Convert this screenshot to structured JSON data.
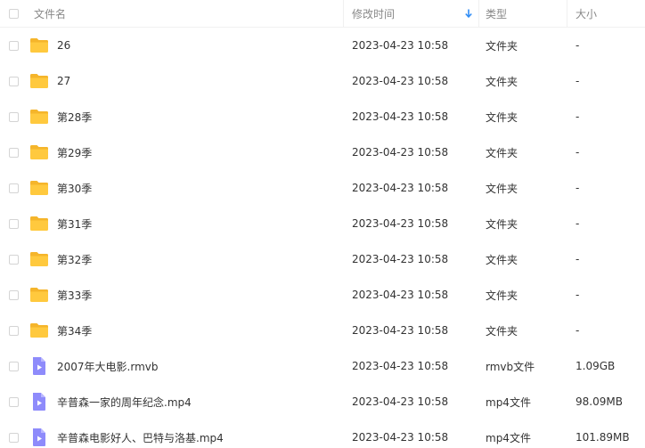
{
  "header": {
    "name_label": "文件名",
    "time_label": "修改时间",
    "type_label": "类型",
    "size_label": "大小",
    "sort_icon": "sort-arrow-down-icon"
  },
  "colors": {
    "folder": "#FFC93E",
    "video": "#8E8BFB",
    "sort_arrow": "#2F8CF5"
  },
  "files": [
    {
      "name": "26",
      "time": "2023-04-23 10:58",
      "type": "文件夹",
      "size": "-",
      "icon": "folder-icon"
    },
    {
      "name": "27",
      "time": "2023-04-23 10:58",
      "type": "文件夹",
      "size": "-",
      "icon": "folder-icon"
    },
    {
      "name": "第28季",
      "time": "2023-04-23 10:58",
      "type": "文件夹",
      "size": "-",
      "icon": "folder-icon"
    },
    {
      "name": "第29季",
      "time": "2023-04-23 10:58",
      "type": "文件夹",
      "size": "-",
      "icon": "folder-icon"
    },
    {
      "name": "第30季",
      "time": "2023-04-23 10:58",
      "type": "文件夹",
      "size": "-",
      "icon": "folder-icon"
    },
    {
      "name": "第31季",
      "time": "2023-04-23 10:58",
      "type": "文件夹",
      "size": "-",
      "icon": "folder-icon"
    },
    {
      "name": "第32季",
      "time": "2023-04-23 10:58",
      "type": "文件夹",
      "size": "-",
      "icon": "folder-icon"
    },
    {
      "name": "第33季",
      "time": "2023-04-23 10:58",
      "type": "文件夹",
      "size": "-",
      "icon": "folder-icon"
    },
    {
      "name": "第34季",
      "time": "2023-04-23 10:58",
      "type": "文件夹",
      "size": "-",
      "icon": "folder-icon"
    },
    {
      "name": "2007年大电影.rmvb",
      "time": "2023-04-23 10:58",
      "type": "rmvb文件",
      "size": "1.09GB",
      "icon": "video-file-icon"
    },
    {
      "name": "辛普森一家的周年纪念.mp4",
      "time": "2023-04-23 10:58",
      "type": "mp4文件",
      "size": "98.09MB",
      "icon": "video-file-icon"
    },
    {
      "name": "辛普森电影好人、巴特与洛基.mp4",
      "time": "2023-04-23 10:58",
      "type": "mp4文件",
      "size": "101.89MB",
      "icon": "video-file-icon"
    }
  ]
}
